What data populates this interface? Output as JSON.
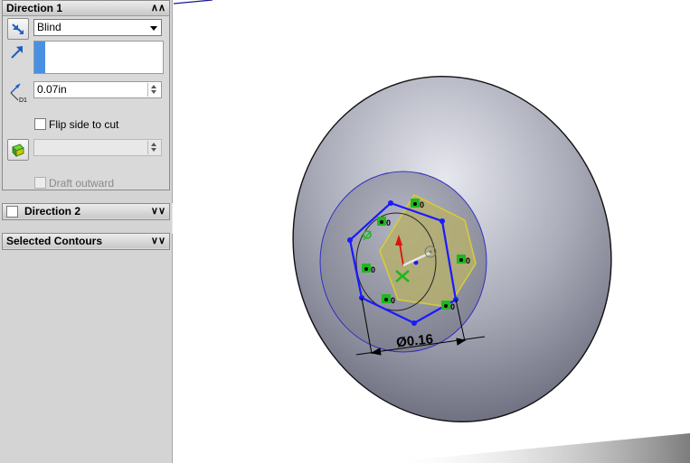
{
  "direction1": {
    "title": "Direction 1",
    "end_condition": "Blind",
    "depth_value": "0.07in",
    "depth_icon_label": "D1",
    "flip_side_label": "Flip side to cut",
    "draft_outward_label": "Draft outward"
  },
  "direction2": {
    "title": "Direction 2"
  },
  "selected_contours": {
    "title": "Selected Contours"
  },
  "viewport": {
    "dimension_label": "Ø0.16",
    "relation_label": "0"
  },
  "colors": {
    "sketch_blue": "#1a1aff",
    "geometry_yellow": "#c8c040",
    "relation_green": "#1db81d",
    "origin_red": "#e01010"
  }
}
